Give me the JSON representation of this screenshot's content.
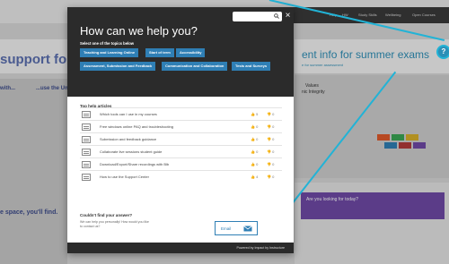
{
  "background": {
    "nav_items": [
      "Help",
      "HW",
      "Study Skills",
      "Wellbeing",
      "Open Courses"
    ],
    "banner_text": "support for c",
    "left_heading_1": "with...",
    "left_heading_2": "...use the Univ",
    "left_subheading": "e space, you'll find.",
    "right_banner_title": "ent info for summer exams",
    "right_banner_sub": "e for summer assessment",
    "right_purple_text": "Are you looking for today?",
    "right_mid_label": "Values",
    "right_mid_sub": "nic Integrity"
  },
  "help_fab": {
    "icon": "question-icon",
    "glyph": "?"
  },
  "widget": {
    "title": "How can we help you?",
    "search_placeholder": "",
    "close_glyph": "×",
    "topics_label": "Select one of the topics below",
    "topics": [
      "Teaching and Learning Online",
      "Start of term",
      "Accessibility",
      "Assessment, Submission and Feedback",
      "Communication and Collaboration",
      "Tests and Surveys"
    ],
    "top_articles_label": "Top help articles",
    "articles": [
      {
        "title": "Which tools can I use in my courses",
        "up": "5",
        "down": "0"
      },
      {
        "title": "Free windows online PAQ and troubleshooting",
        "up": "0",
        "down": "0"
      },
      {
        "title": "Submission and feedback guidance",
        "up": "0",
        "down": "0"
      },
      {
        "title": "Collaborate live sessions student guide",
        "up": "0",
        "down": "0"
      },
      {
        "title": "Download/Export/Share recordings with Blb",
        "up": "0",
        "down": "0"
      },
      {
        "title": "How to use the Support Center",
        "up": "4",
        "down": "0"
      }
    ],
    "cant_find_label": "Couldn't find your answer?",
    "cant_find_sub": "We can help you personally! How would you like to contact us?",
    "email_label": "Email",
    "footer": "Powered by Impact by Instructure"
  },
  "colors": {
    "accent": "#2f7fb5",
    "header": "#2b2b2b",
    "annotation": "#22b3d6"
  }
}
